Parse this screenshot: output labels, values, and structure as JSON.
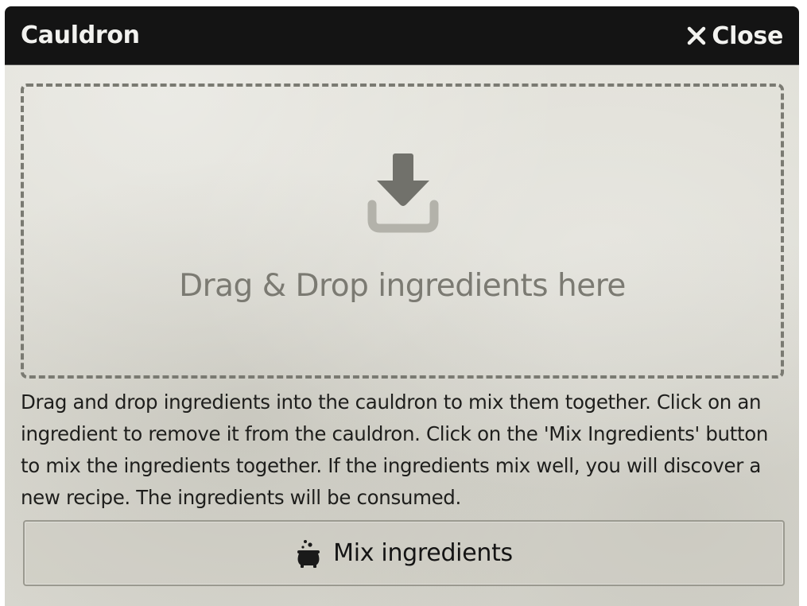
{
  "window": {
    "title": "Cauldron",
    "close_label": "Close",
    "close_icon": "close-x-icon"
  },
  "dropzone": {
    "icon": "download-icon",
    "text": "Drag & Drop ingredients here"
  },
  "instructions": {
    "text": "Drag and drop ingredients into the cauldron to mix them together. Click on an ingredient to remove it from the cauldron. Click on the 'Mix Ingredients' button to mix the ingredients together. If the ingredients mix well, you will discover a new recipe. The ingredients will be consumed."
  },
  "actions": {
    "mix_label": "Mix ingredients",
    "mix_icon": "cauldron-icon"
  },
  "colors": {
    "header_bg": "#141414",
    "panel_bg": "#dcdbd3",
    "dropzone_border": "#7a7a72",
    "muted_text": "#7b7a72",
    "body_text": "#1e1e1c"
  }
}
